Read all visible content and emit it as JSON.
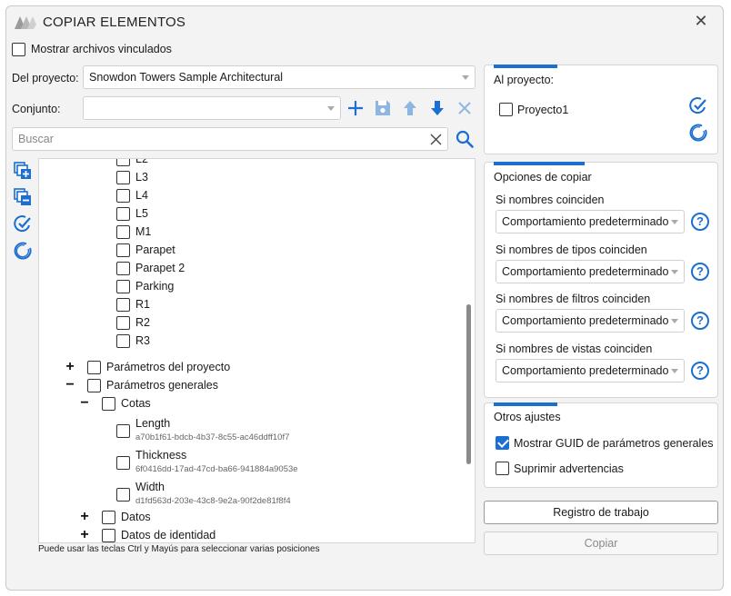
{
  "window": {
    "title": "COPIAR ELEMENTOS"
  },
  "show_linked": {
    "label": "Mostrar archivos vinculados",
    "checked": false
  },
  "from_project": {
    "label": "Del proyecto:",
    "value": "Snowdon Towers Sample Architectural"
  },
  "set": {
    "label": "Conjunto:",
    "value": ""
  },
  "search": {
    "placeholder": "Buscar"
  },
  "tree": {
    "levels": [
      "L2",
      "L3",
      "L4",
      "L5",
      "M1",
      "Parapet",
      "Parapet 2",
      "Parking",
      "R1",
      "R2",
      "R3"
    ],
    "project_params": {
      "label": "Parámetros del proyecto",
      "expander": "+"
    },
    "global_params": {
      "label": "Parámetros generales",
      "expander": "−"
    },
    "cotas": {
      "label": "Cotas",
      "expander": "−"
    },
    "params": [
      {
        "name": "Length",
        "guid": "a70b1f61-bdcb-4b37-8c55-ac46ddff10f7"
      },
      {
        "name": "Thickness",
        "guid": "6f0416dd-17ad-47cd-ba66-941884a9053e"
      },
      {
        "name": "Width",
        "guid": "d1fd563d-203e-43c8-9e2a-90f2de81f8f4"
      }
    ],
    "datos": {
      "label": "Datos",
      "expander": "+"
    },
    "identity": {
      "label": "Datos de identidad",
      "expander": "+"
    }
  },
  "hint": "Puede usar las teclas Ctrl y Mayús para seleccionar varias posiciones",
  "to_project": {
    "title": "Al proyecto:",
    "items": [
      {
        "label": "Proyecto1",
        "checked": false
      }
    ]
  },
  "copy_options": {
    "title": "Opciones de copiar",
    "rows": [
      {
        "label": "Si nombres coinciden",
        "value": "Comportamiento predeterminado"
      },
      {
        "label": "Si nombres de tipos coinciden",
        "value": "Comportamiento predeterminado"
      },
      {
        "label": "Si nombres de filtros coinciden",
        "value": "Comportamiento predeterminado"
      },
      {
        "label": "Si nombres de vistas coinciden",
        "value": "Comportamiento predeterminado"
      }
    ],
    "help_glyph": "?"
  },
  "other_settings": {
    "title": "Otros ajustes",
    "show_guid": {
      "label": "Mostrar GUID de parámetros generales",
      "checked": true
    },
    "suppress_warnings": {
      "label": "Suprimir advertencias",
      "checked": false
    }
  },
  "buttons": {
    "log": "Registro de trabajo",
    "copy": "Copiar"
  },
  "colors": {
    "accent": "#1a6fd1",
    "accent_light": "#8fb5e2"
  },
  "icons": [
    "app-logo-icon",
    "close-icon",
    "plus-icon",
    "save-icon",
    "arrow-up-icon",
    "arrow-down-icon",
    "delete-icon",
    "clear-icon",
    "search-icon",
    "expand-all-icon",
    "collapse-all-icon",
    "select-all-icon",
    "deselect-all-icon"
  ]
}
